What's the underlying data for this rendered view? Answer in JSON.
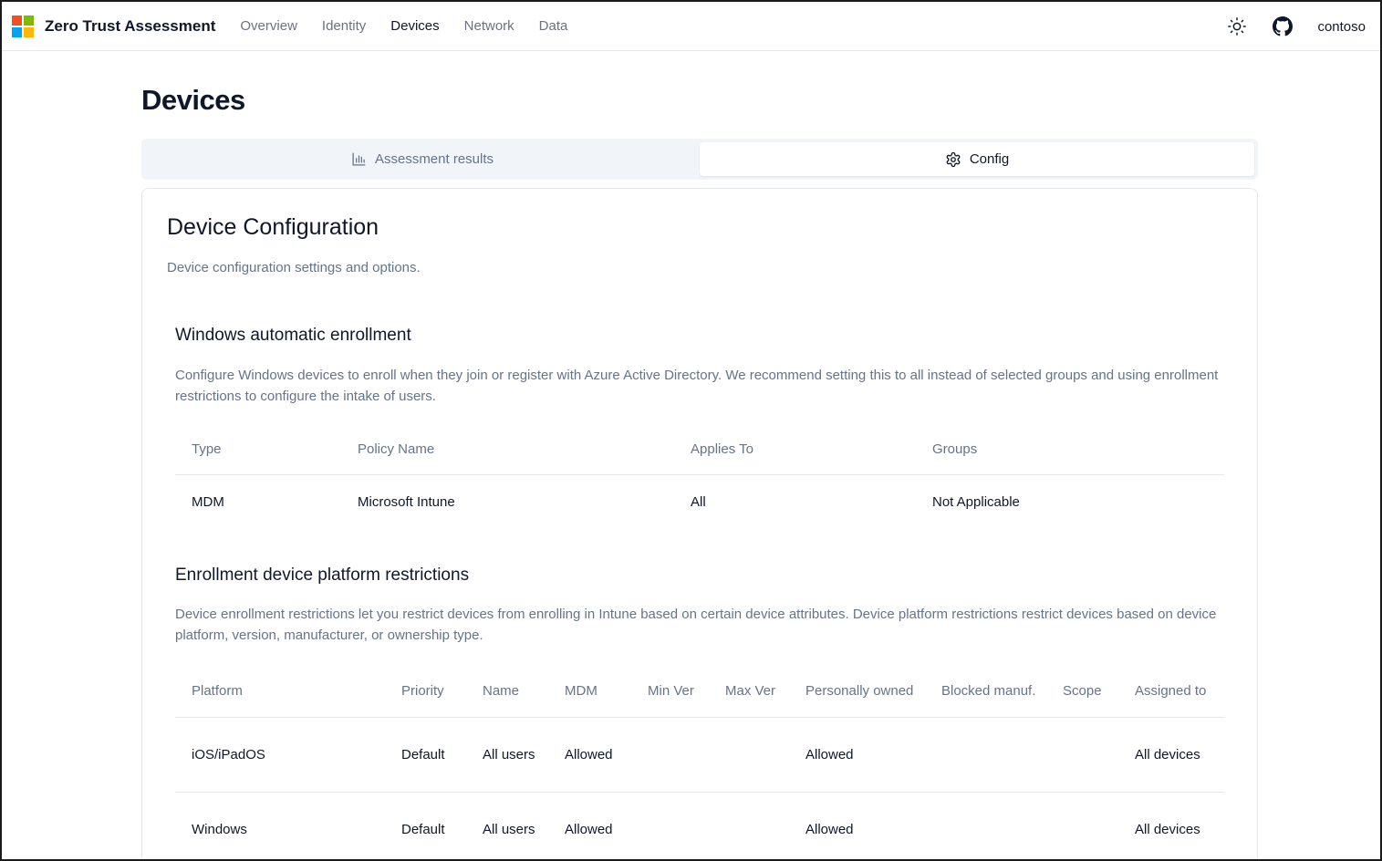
{
  "app": {
    "brand": "Zero Trust Assessment",
    "logo_colors": [
      "#f25022",
      "#7fba00",
      "#00a4ef",
      "#ffb900"
    ],
    "nav": [
      {
        "label": "Overview",
        "active": false
      },
      {
        "label": "Identity",
        "active": false
      },
      {
        "label": "Devices",
        "active": true
      },
      {
        "label": "Network",
        "active": false
      },
      {
        "label": "Data",
        "active": false
      }
    ],
    "icons": [
      "sun-icon",
      "github-icon"
    ],
    "tenant": "contoso"
  },
  "page": {
    "title": "Devices",
    "tabs": [
      {
        "label": "Assessment results",
        "icon": "bar-chart-icon",
        "active": false
      },
      {
        "label": "Config",
        "icon": "gear-icon",
        "active": true
      }
    ]
  },
  "card": {
    "title": "Device Configuration",
    "description": "Device configuration settings and options."
  },
  "windows_enrollment": {
    "title": "Windows automatic enrollment",
    "description": "Configure Windows devices to enroll when they join or register with Azure Active Directory. We recommend setting this to all instead of selected groups and using enrollment restrictions to configure the intake of users.",
    "columns": [
      "Type",
      "Policy Name",
      "Applies To",
      "Groups"
    ],
    "rows": [
      [
        "MDM",
        "Microsoft Intune",
        "All",
        "Not Applicable"
      ]
    ]
  },
  "platform_restrictions": {
    "title": "Enrollment device platform restrictions",
    "description": "Device enrollment restrictions let you restrict devices from enrolling in Intune based on certain device attributes. Device platform restrictions restrict devices based on device platform, version, manufacturer, or ownership type.",
    "columns": [
      "Platform",
      "Priority",
      "Name",
      "MDM",
      "Min Ver",
      "Max Ver",
      "Personally owned",
      "Blocked manuf.",
      "Scope",
      "Assigned to"
    ],
    "rows": [
      [
        "iOS/iPadOS",
        "Default",
        "All users",
        "Allowed",
        "",
        "",
        "Allowed",
        "",
        "",
        "All devices"
      ],
      [
        "Windows",
        "Default",
        "All users",
        "Allowed",
        "",
        "",
        "Allowed",
        "",
        "",
        "All devices"
      ]
    ]
  }
}
